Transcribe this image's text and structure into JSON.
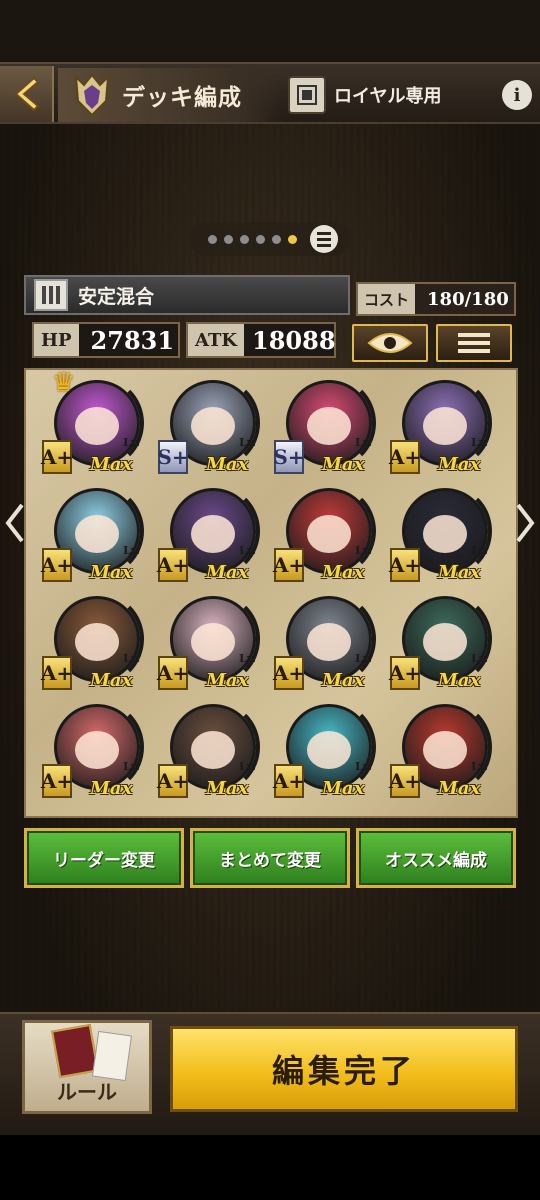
{
  "header": {
    "back_icon": "chevron-left-icon",
    "emblem_icon": "crown-shield-icon",
    "title": "デッキ編成",
    "format_icon": "format-icon",
    "format_label": "ロイヤル専用",
    "info_label": "i"
  },
  "pager": {
    "dots": 6,
    "active_index": 5,
    "list_icon": "list-icon"
  },
  "deck": {
    "class_icon": "royal-class-icon",
    "name": "安定混合",
    "cost_label": "コスト",
    "cost_value": "180/180",
    "hp_label": "HP",
    "hp_value": "27831",
    "atk_label": "ATK",
    "atk_value": "18088",
    "view_icon": "eye-icon",
    "menu_icon": "menu-icon"
  },
  "cards": [
    {
      "rarity": "A+",
      "lv": "Lv.",
      "max": "Max",
      "leader": true,
      "color": "#c25ad1"
    },
    {
      "rarity": "S+",
      "lv": "Lv.",
      "max": "Max",
      "color": "#9aa3b8"
    },
    {
      "rarity": "S+",
      "lv": "Lv.",
      "max": "Max",
      "color": "#d84b73"
    },
    {
      "rarity": "A+",
      "lv": "Lv.",
      "max": "Max",
      "color": "#8c6fb6"
    },
    {
      "rarity": "A+",
      "lv": "Lv.",
      "max": "Max",
      "color": "#8fd0e6"
    },
    {
      "rarity": "A+",
      "lv": "Lv.",
      "max": "Max",
      "color": "#6b4a8a"
    },
    {
      "rarity": "A+",
      "lv": "Lv.",
      "max": "Max",
      "color": "#c23b3b"
    },
    {
      "rarity": "A+",
      "lv": "Lv.",
      "max": "Max",
      "color": "#2b2b3a"
    },
    {
      "rarity": "A+",
      "lv": "Lv.",
      "max": "Max",
      "color": "#8a5a3a"
    },
    {
      "rarity": "A+",
      "lv": "Lv.",
      "max": "Max",
      "color": "#d9b2c0"
    },
    {
      "rarity": "A+",
      "lv": "Lv.",
      "max": "Max",
      "color": "#7f8791"
    },
    {
      "rarity": "A+",
      "lv": "Lv.",
      "max": "Max",
      "color": "#3c6b5b"
    },
    {
      "rarity": "A+",
      "lv": "Lv.",
      "max": "Max",
      "color": "#d66a6a"
    },
    {
      "rarity": "A+",
      "lv": "Lv.",
      "max": "Max",
      "color": "#6a4f3f"
    },
    {
      "rarity": "A+",
      "lv": "Lv.",
      "max": "Max",
      "color": "#47b9c7"
    },
    {
      "rarity": "A+",
      "lv": "Lv.",
      "max": "Max",
      "color": "#b93a2f"
    }
  ],
  "nav": {
    "prev_icon": "chevron-left-icon",
    "next_icon": "chevron-right-icon"
  },
  "actions": {
    "leader_change": "リーダー変更",
    "bulk_change": "まとめて変更",
    "recommended": "オススメ編成"
  },
  "footer": {
    "rule_label": "ルール",
    "done_label": "編集完了"
  }
}
